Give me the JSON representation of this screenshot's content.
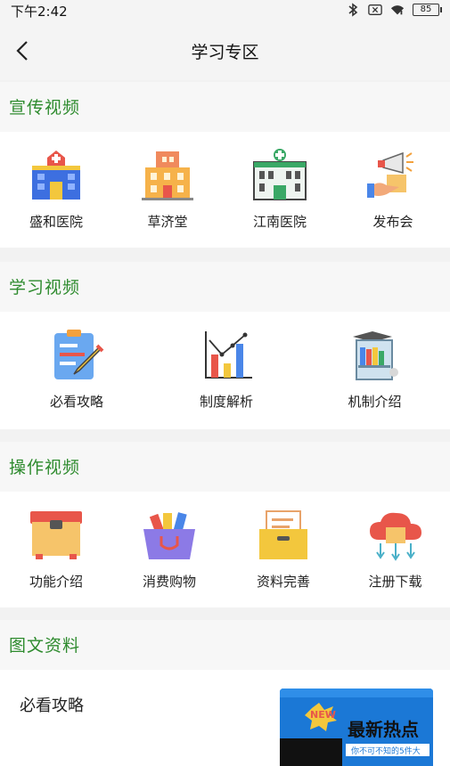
{
  "status_bar": {
    "time": "下午2:42",
    "battery": "85"
  },
  "nav": {
    "title": "学习专区"
  },
  "sections": [
    {
      "title": "宣传视频",
      "items": [
        {
          "label": "盛和医院",
          "icon": "hospital-blue-icon"
        },
        {
          "label": "草济堂",
          "icon": "building-orange-icon"
        },
        {
          "label": "江南医院",
          "icon": "hospital-green-icon"
        },
        {
          "label": "发布会",
          "icon": "megaphone-icon"
        }
      ]
    },
    {
      "title": "学习视频",
      "items": [
        {
          "label": "必看攻略",
          "icon": "clipboard-pen-icon"
        },
        {
          "label": "制度解析",
          "icon": "bar-chart-icon"
        },
        {
          "label": "机制介绍",
          "icon": "bookshelf-icon"
        }
      ]
    },
    {
      "title": "操作视频",
      "items": [
        {
          "label": "功能介绍",
          "icon": "box-icon"
        },
        {
          "label": "消费购物",
          "icon": "shopping-bag-icon"
        },
        {
          "label": "资料完善",
          "icon": "file-box-icon"
        },
        {
          "label": "注册下载",
          "icon": "cloud-download-icon"
        }
      ]
    },
    {
      "title": "图文资料"
    }
  ],
  "documents": [
    {
      "title": "必看攻略",
      "thumb": {
        "badge": "NEW",
        "headline": "最新热点",
        "sub": "你不可不知的5件大"
      }
    }
  ]
}
